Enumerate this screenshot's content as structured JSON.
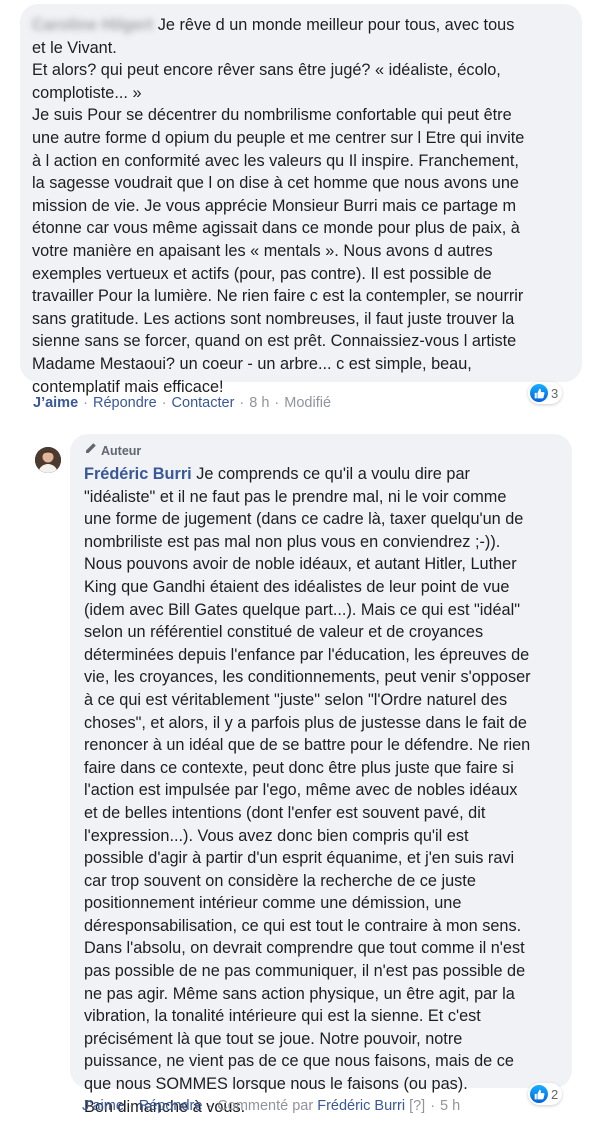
{
  "comment1": {
    "author": "Caroline Hilgert",
    "lines": [
      " Je rêve d un monde meilleur pour tous, avec tous",
      "et le Vivant.",
      "Et alors? qui peut encore rêver sans être jugé? « idéaliste, écolo,",
      "complotiste... »",
      "Je suis Pour se décentrer du nombrilisme confortable qui peut être",
      "une autre forme d opium du peuple et me centrer sur l Etre qui invite",
      "à l action en conformité avec les valeurs qu Il inspire. Franchement,",
      "la sagesse voudrait que l on dise à cet homme que nous avons une",
      "mission de vie. Je vous apprécie Monsieur Burri mais ce partage m",
      "étonne car vous même agissait dans ce monde pour plus de paix, à",
      "votre manière en apaisant les « mentals ». Nous avons d autres",
      "exemples vertueux et actifs (pour, pas contre). Il est possible de",
      "travailler Pour la lumière. Ne rien faire c est la contempler, se nourrir",
      "sans gratitude. Les actions sont nombreuses, il faut juste trouver la",
      "sienne sans se forcer, quand on est prêt. Connaissiez-vous l artiste",
      "Madame Mestaoui? un coeur - un arbre... c est simple, beau,",
      "contemplatif mais efficace!"
    ],
    "reactions_count": "3",
    "actions": {
      "like": "J’aime",
      "reply": "Répondre",
      "contact": "Contacter",
      "time": "8 h",
      "edited": "Modifié"
    }
  },
  "comment2": {
    "badge": "Auteur",
    "author": "Frédéric Burri",
    "lines": [
      " Je comprends ce qu'il a voulu dire par",
      "\"idéaliste\" et il ne faut pas le prendre mal, ni le voir comme",
      "une forme de jugement (dans ce cadre là, taxer quelqu'un de",
      "nombriliste est pas mal non plus vous en conviendrez ;-)).",
      "Nous pouvons avoir de noble idéaux, et autant Hitler, Luther",
      "King que Gandhi étaient des idéalistes de leur point de vue",
      "(idem avec Bill Gates quelque part...). Mais ce qui est \"idéal\"",
      "selon un référentiel constitué de valeur et de croyances",
      "déterminées depuis l'enfance par l'éducation, les épreuves de",
      "vie, les croyances, les conditionnements, peut venir s'opposer",
      "à ce qui est véritablement \"juste\" selon \"l'Ordre naturel des",
      "choses\", et alors, il y a parfois plus de justesse dans le fait de",
      "renoncer à un idéal que de se battre pour le défendre. Ne rien",
      "faire dans ce contexte, peut donc être plus juste que faire si",
      "l'action est impulsée par l'ego, même avec de nobles idéaux",
      "et de belles intentions (dont l'enfer est souvent pavé, dit",
      "l'expression...). Vous avez donc bien compris qu'il est",
      "possible d'agir à partir d'un esprit équanime, et j'en suis ravi",
      "car trop souvent on considère la recherche de ce juste",
      "positionnement intérieur comme une démission, une",
      "déresponsabilisation, ce qui est tout le contraire à mon sens.",
      "Dans l'absolu, on devrait comprendre que tout comme il n'est",
      "pas possible de ne pas communiquer, il n'est pas possible de",
      "ne pas agir. Même sans action physique, un être agit, par la",
      "vibration, la tonalité intérieure qui est la sienne. Et c'est",
      "précisément là que tout se joue. Notre pouvoir, notre",
      "puissance, ne vient pas de ce que nous faisons, mais de ce",
      "que nous SOMMES lorsque nous le faisons (ou pas).",
      "Bon dimanche à vous."
    ],
    "reactions_count": "2",
    "actions": {
      "like": "J’aime",
      "reply": "Répondre",
      "commented_by": "Commenté par",
      "commented_author": "Frédéric Burri",
      "help": "[?]",
      "time": "5 h"
    }
  },
  "icons": {
    "like": "like-thumb-icon",
    "author_badge": "pencil-icon",
    "avatar": "profile-avatar"
  },
  "colors": {
    "link": "#385898",
    "bubble": "#f0f2f5",
    "meta": "#90949c",
    "like_blue": "#1877f2"
  }
}
